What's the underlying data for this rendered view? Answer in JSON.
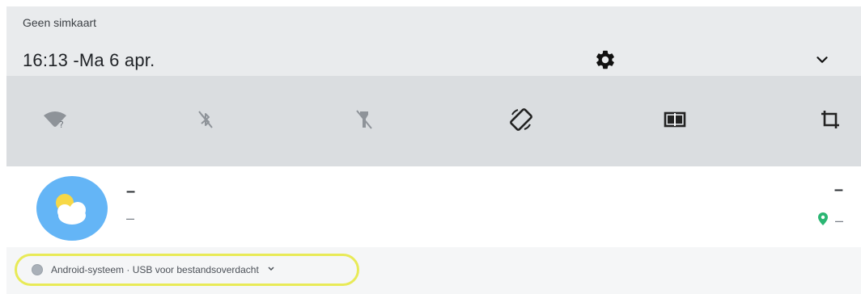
{
  "status": {
    "carrier": "Geen simkaart",
    "datetime": "16:13 -Ma 6 apr."
  },
  "quick_tiles": [
    {
      "icon": "wifi-unknown-icon"
    },
    {
      "icon": "bluetooth-off-icon"
    },
    {
      "icon": "flashlight-off-icon"
    },
    {
      "icon": "auto-rotate-icon"
    },
    {
      "icon": "cast-screen-icon"
    },
    {
      "icon": "crop-icon"
    }
  ],
  "media_card": {
    "title": "–",
    "subtitle": "–",
    "right_value": "–",
    "location_value": "–"
  },
  "notification": {
    "text": "Android-systeem · USB voor bestandsoverdacht"
  },
  "colors": {
    "accent_yellow": "#e8ea57",
    "weather_bg": "#64b5f6",
    "location_green": "#2bb673"
  }
}
